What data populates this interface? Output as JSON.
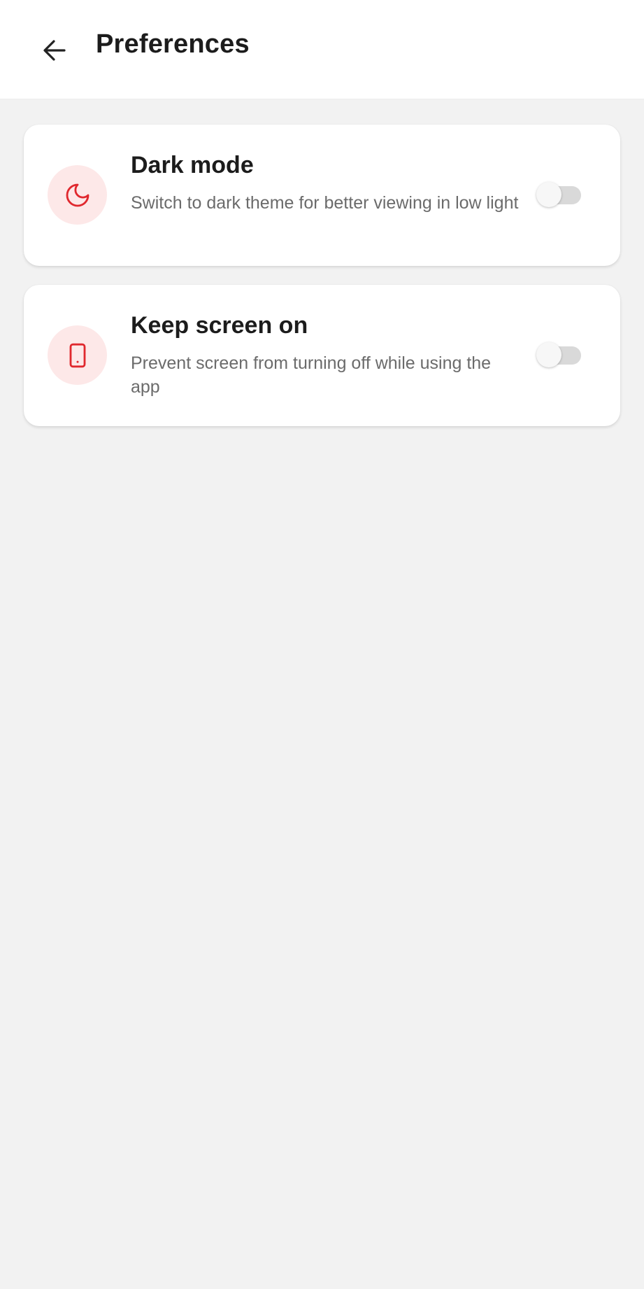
{
  "header": {
    "title": "Preferences"
  },
  "settings": [
    {
      "title": "Dark mode",
      "description": "Switch to dark theme for better viewing in low light",
      "icon": "moon-icon",
      "enabled": false
    },
    {
      "title": "Keep screen on",
      "description": "Prevent screen from turning off while using the app",
      "icon": "phone-icon",
      "enabled": false
    }
  ],
  "colors": {
    "accent": "#e0282e",
    "icon_background": "#fde8e8",
    "page_background": "#f2f2f2"
  }
}
